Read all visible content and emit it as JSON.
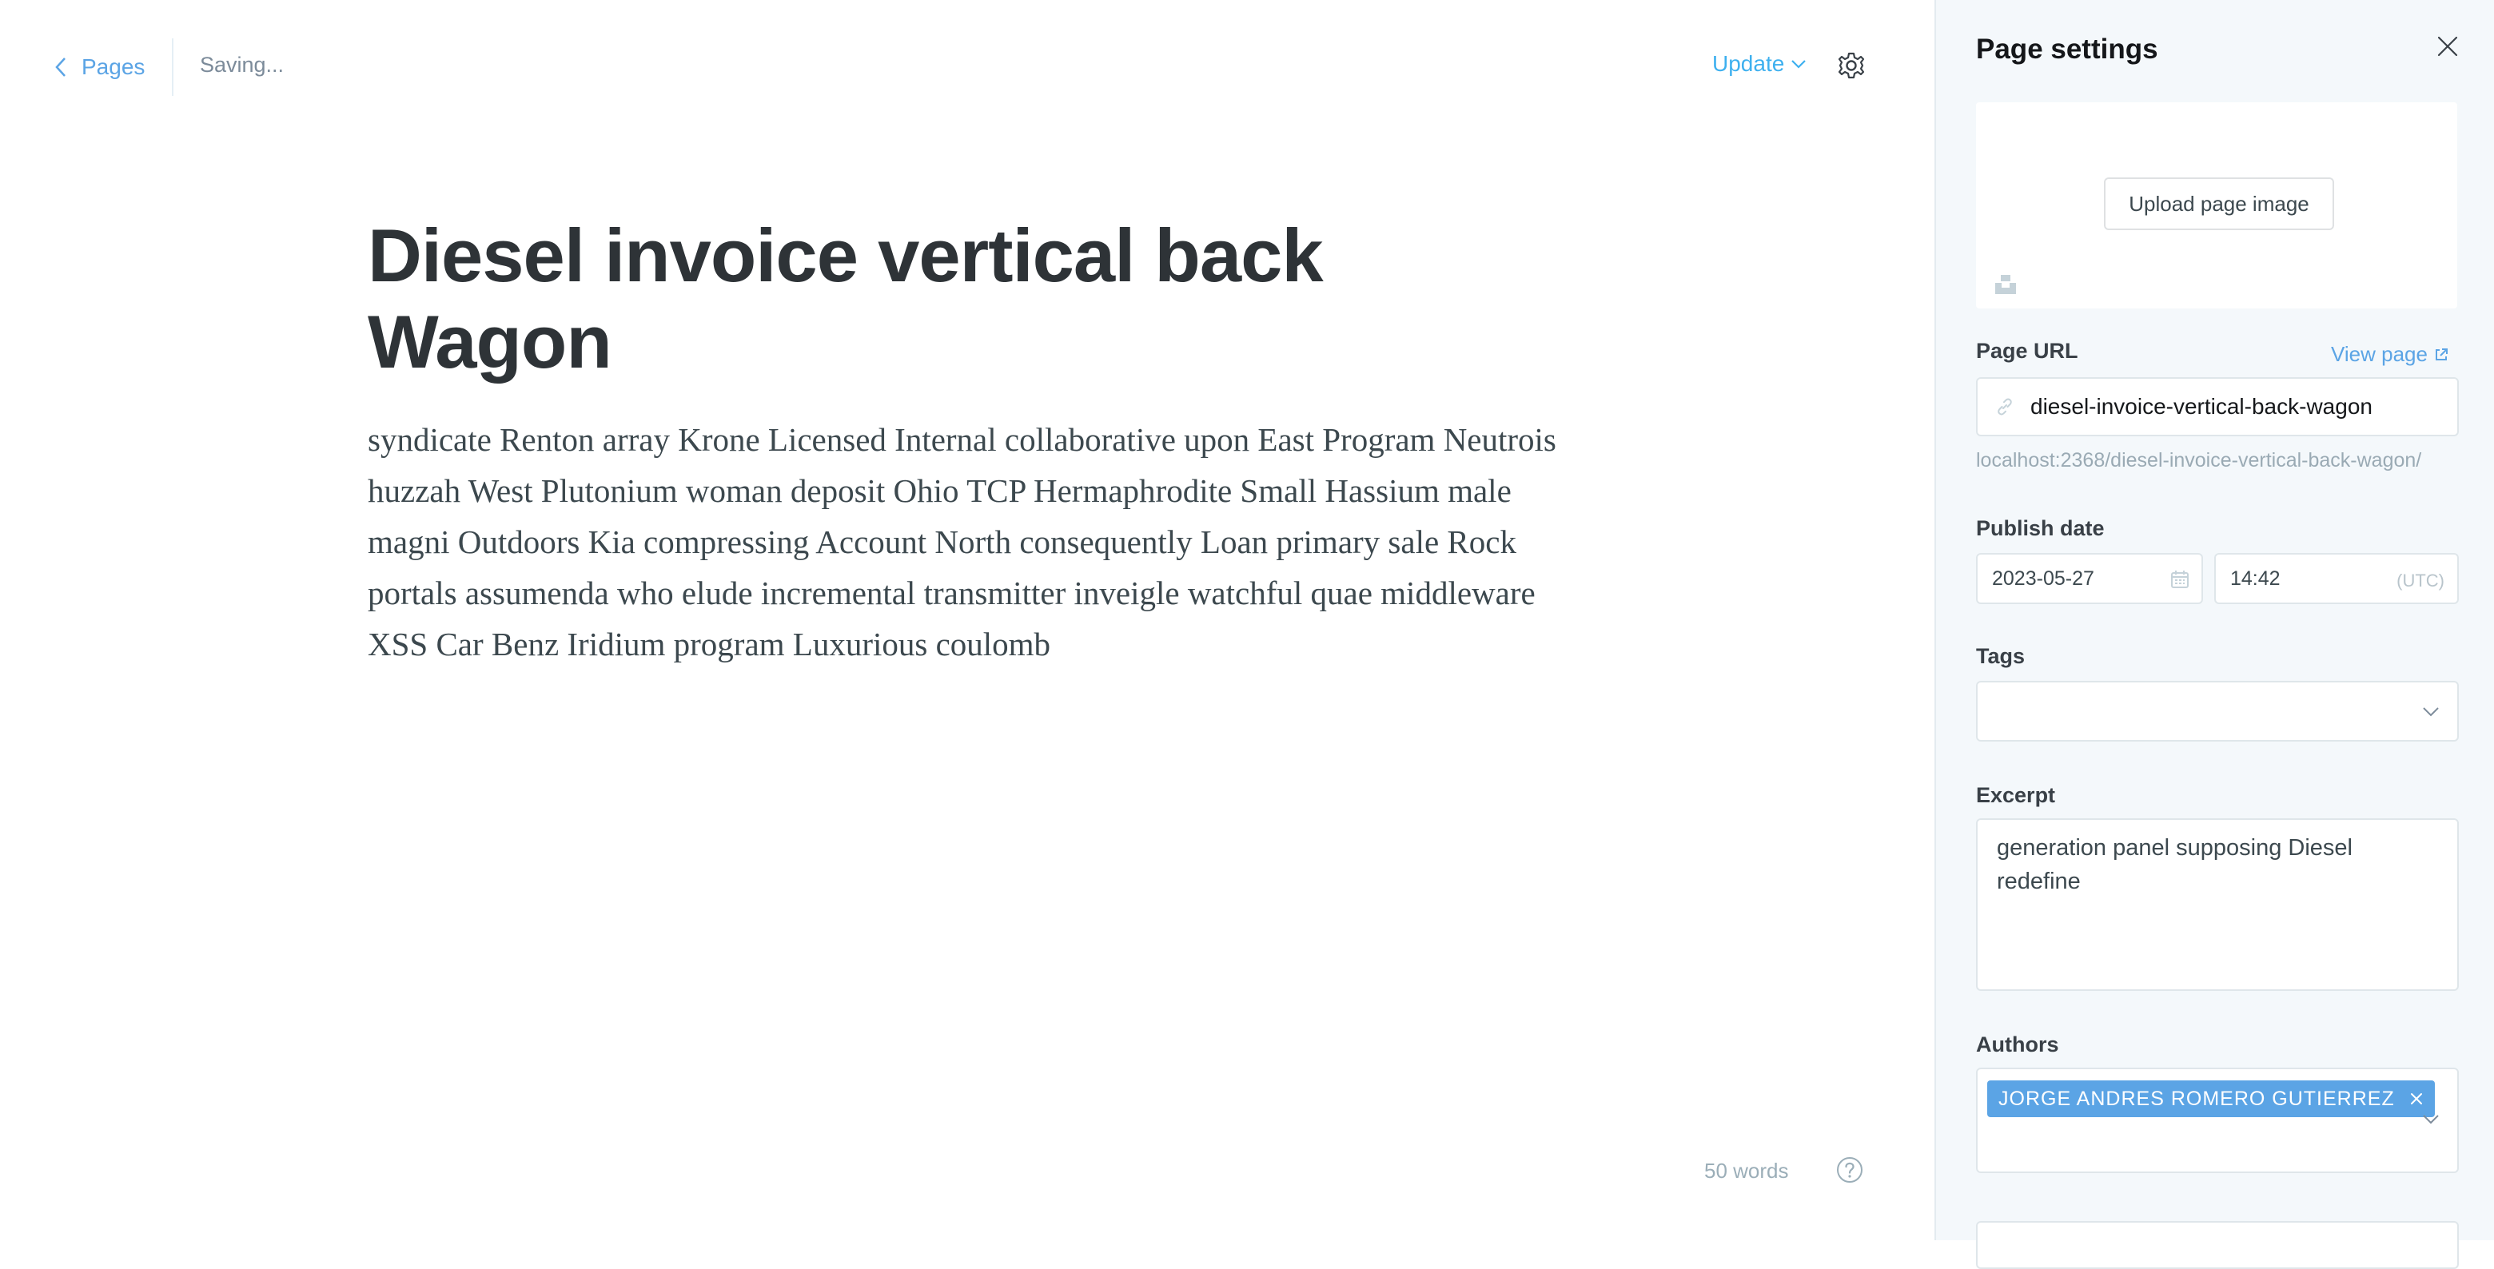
{
  "header": {
    "back_label": "Pages",
    "status": "Saving...",
    "update_label": "Update"
  },
  "post": {
    "title": "Diesel invoice vertical back Wagon",
    "body": "syndicate Renton array Krone Licensed Internal collaborative upon East Program Neutrois huzzah West Plutonium woman deposit Ohio TCP Hermaphrodite Small Hassium male magni Outdoors Kia compressing Account North consequently Loan primary sale Rock portals assumenda who elude incremental transmitter inveigle watchful quae middleware XSS Car Benz Iridium program Luxurious coulomb",
    "word_count": "50 words"
  },
  "settings": {
    "title": "Page settings",
    "upload_label": "Upload page image",
    "url_label": "Page URL",
    "view_page_label": "View page",
    "url_value": "diesel-invoice-vertical-back-wagon",
    "url_hint": "localhost:2368/diesel-invoice-vertical-back-wagon/",
    "publish_label": "Publish date",
    "date_value": "2023-05-27",
    "time_value": "14:42",
    "timezone": "(UTC)",
    "tags_label": "Tags",
    "excerpt_label": "Excerpt",
    "excerpt_value": "generation panel supposing Diesel redefine",
    "authors_label": "Authors",
    "authors": [
      "JORGE ANDRES ROMERO GUTIERREZ"
    ]
  },
  "colors": {
    "accent": "#5ba4e5",
    "panel_bg": "#f4f8fb",
    "title_text": "#2e3337"
  }
}
